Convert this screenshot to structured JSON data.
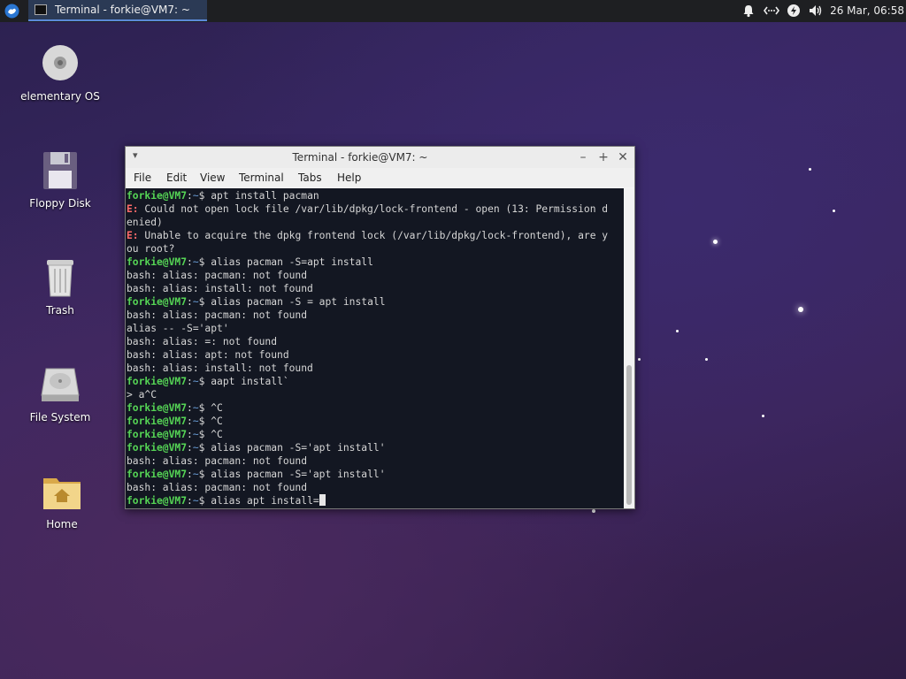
{
  "panel": {
    "task_title": "Terminal - forkie@VM7: ~",
    "clock": "26 Mar, 06:58"
  },
  "desktop_icons": [
    {
      "label": "elementary OS"
    },
    {
      "label": "Floppy Disk"
    },
    {
      "label": "Trash"
    },
    {
      "label": "File System"
    },
    {
      "label": "Home"
    }
  ],
  "window": {
    "title": "Terminal - forkie@VM7: ~",
    "menu": [
      "File",
      "Edit",
      "View",
      "Terminal",
      "Tabs",
      "Help"
    ]
  },
  "terminal": {
    "prompt_user": "forkie@VM7",
    "prompt_sep": ":",
    "prompt_dir": "~",
    "prompt_char": "$",
    "error_tag": "E:",
    "lines": [
      {
        "t": "cmd",
        "text": " apt install pacman"
      },
      {
        "t": "err",
        "text": " Could not open lock file /var/lib/dpkg/lock-frontend - open (13: Permission d"
      },
      {
        "t": "out",
        "text": "enied)"
      },
      {
        "t": "err",
        "text": " Unable to acquire the dpkg frontend lock (/var/lib/dpkg/lock-frontend), are y"
      },
      {
        "t": "out",
        "text": "ou root?"
      },
      {
        "t": "cmd",
        "text": " alias pacman -S=apt install"
      },
      {
        "t": "out",
        "text": "bash: alias: pacman: not found"
      },
      {
        "t": "out",
        "text": "bash: alias: install: not found"
      },
      {
        "t": "cmd",
        "text": " alias pacman -S = apt install"
      },
      {
        "t": "out",
        "text": "bash: alias: pacman: not found"
      },
      {
        "t": "out",
        "text": "alias -- -S='apt'"
      },
      {
        "t": "out",
        "text": "bash: alias: =: not found"
      },
      {
        "t": "out",
        "text": "bash: alias: apt: not found"
      },
      {
        "t": "out",
        "text": "bash: alias: install: not found"
      },
      {
        "t": "cmd",
        "text": " aapt install`"
      },
      {
        "t": "out",
        "text": "> a^C"
      },
      {
        "t": "cmd",
        "text": " ^C"
      },
      {
        "t": "cmd",
        "text": " ^C"
      },
      {
        "t": "cmd",
        "text": " ^C"
      },
      {
        "t": "cmd",
        "text": " alias pacman -S='apt install'"
      },
      {
        "t": "out",
        "text": "bash: alias: pacman: not found"
      },
      {
        "t": "cmd",
        "text": " alias pacman -S='apt install'"
      },
      {
        "t": "out",
        "text": "bash: alias: pacman: not found"
      },
      {
        "t": "cur",
        "text": " alias apt install="
      }
    ]
  }
}
